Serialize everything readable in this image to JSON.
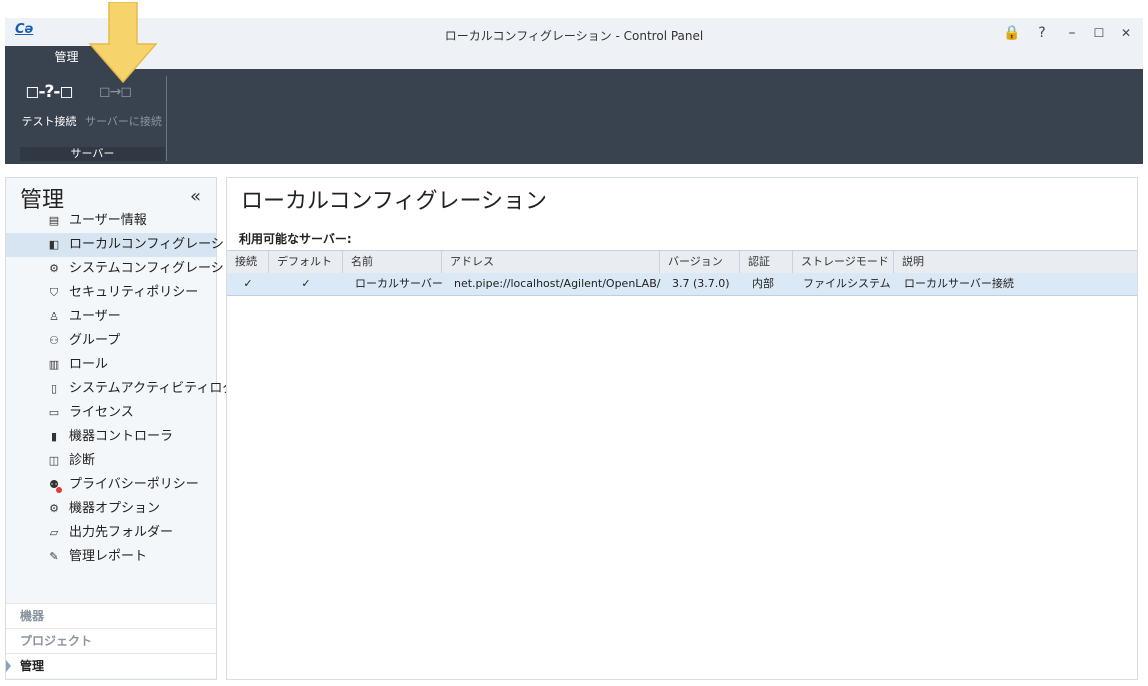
{
  "window": {
    "logo": "Cǝ",
    "title": "ローカルコンフィグレーション - Control Panel",
    "lock_icon": "🔒",
    "help": "?",
    "minimize": "–",
    "maximize": "☐",
    "close": "✕"
  },
  "ribbon": {
    "tab": "管理",
    "buttons": [
      {
        "label": "テスト接続",
        "icon": "test-connection-icon",
        "glyph": "◻-?-◻"
      },
      {
        "label": "サーバーに接続",
        "icon": "connect-server-icon",
        "glyph": "◻→◻"
      }
    ],
    "group_label": "サーバー"
  },
  "sidebar": {
    "title": "管理",
    "collapse": "«",
    "items": [
      {
        "label": "ユーザー情報",
        "icon": "user-info-icon",
        "glyph": "▤"
      },
      {
        "label": "ローカルコンフィグレーション",
        "icon": "local-config-icon",
        "glyph": "◧"
      },
      {
        "label": "システムコンフィグレーション",
        "icon": "gear-icon",
        "glyph": "⚙"
      },
      {
        "label": "セキュリティポリシー",
        "icon": "shield-icon",
        "glyph": "⛉"
      },
      {
        "label": "ユーザー",
        "icon": "user-icon",
        "glyph": "♙"
      },
      {
        "label": "グループ",
        "icon": "group-icon",
        "glyph": "⚇"
      },
      {
        "label": "ロール",
        "icon": "role-icon",
        "glyph": "▥"
      },
      {
        "label": "システムアクティビティログ",
        "icon": "activity-log-icon",
        "glyph": "▯"
      },
      {
        "label": "ライセンス",
        "icon": "license-icon",
        "glyph": "▭"
      },
      {
        "label": "機器コントローラ",
        "icon": "instrument-controller-icon",
        "glyph": "▮"
      },
      {
        "label": "診断",
        "icon": "diagnostics-icon",
        "glyph": "◫"
      },
      {
        "label": "プライバシーポリシー",
        "icon": "privacy-icon",
        "glyph": "⚉"
      },
      {
        "label": "機器オプション",
        "icon": "instrument-options-icon",
        "glyph": "⚙"
      },
      {
        "label": "出力先フォルダー",
        "icon": "folder-icon",
        "glyph": "▱"
      },
      {
        "label": "管理レポート",
        "icon": "report-icon",
        "glyph": "✎"
      }
    ],
    "sections": [
      {
        "label": "機器"
      },
      {
        "label": "プロジェクト"
      },
      {
        "label": "管理"
      }
    ]
  },
  "main": {
    "title": "ローカルコンフィグレーション",
    "servers_label": "利用可能なサーバー:",
    "columns": [
      "接続",
      "デフォルト",
      "名前",
      "アドレス",
      "バージョン",
      "認証",
      "ストレージモード",
      "説明"
    ],
    "rows": [
      {
        "connected": "✓",
        "default": "✓",
        "name": "ローカルサーバー",
        "address": "net.pipe://localhost/Agilent/OpenLAB/",
        "version": "3.7 (3.7.0)",
        "auth": "内部",
        "storage": "ファイルシステム",
        "description": "ローカルサーバー接続"
      }
    ]
  },
  "colors": {
    "ribbon_bg": "#394350",
    "selected_row": "#dbe9f6",
    "arrow": "#f6d36b"
  }
}
